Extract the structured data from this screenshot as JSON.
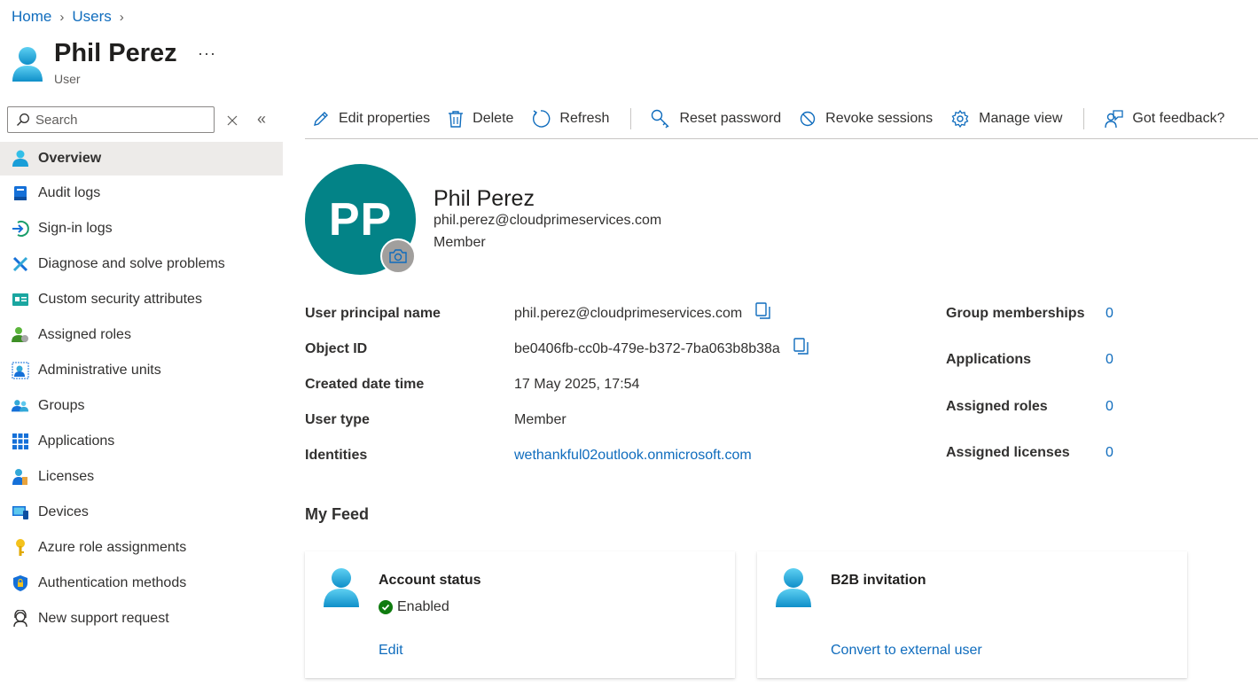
{
  "breadcrumb": {
    "home": "Home",
    "users": "Users"
  },
  "header": {
    "title": "Phil Perez",
    "subtitle": "User",
    "more": "···"
  },
  "search": {
    "placeholder": "Search"
  },
  "sidebar": {
    "items": [
      {
        "label": "Overview",
        "icon": "user-icon"
      },
      {
        "label": "Audit logs",
        "icon": "audit-log-icon"
      },
      {
        "label": "Sign-in logs",
        "icon": "sign-in-icon"
      },
      {
        "label": "Diagnose and solve problems",
        "icon": "wrench-icon"
      },
      {
        "label": "Custom security attributes",
        "icon": "attributes-icon"
      },
      {
        "label": "Assigned roles",
        "icon": "assigned-roles-icon"
      },
      {
        "label": "Administrative units",
        "icon": "admin-units-icon"
      },
      {
        "label": "Groups",
        "icon": "groups-icon"
      },
      {
        "label": "Applications",
        "icon": "applications-grid-icon"
      },
      {
        "label": "Licenses",
        "icon": "licenses-icon"
      },
      {
        "label": "Devices",
        "icon": "devices-icon"
      },
      {
        "label": "Azure role assignments",
        "icon": "key-icon"
      },
      {
        "label": "Authentication methods",
        "icon": "shield-icon"
      },
      {
        "label": "New support request",
        "icon": "support-icon"
      }
    ]
  },
  "toolbar": {
    "edit": "Edit properties",
    "delete": "Delete",
    "refresh": "Refresh",
    "reset_password": "Reset password",
    "revoke_sessions": "Revoke sessions",
    "manage_view": "Manage view",
    "feedback": "Got feedback?"
  },
  "profile": {
    "initials": "PP",
    "name": "Phil Perez",
    "email": "phil.perez@cloudprimeservices.com",
    "user_type": "Member"
  },
  "properties": {
    "upn_label": "User principal name",
    "upn_value": "phil.perez@cloudprimeservices.com",
    "objectid_label": "Object ID",
    "objectid_value": "be0406fb-cc0b-479e-b372-7ba063b8b38a",
    "created_label": "Created date time",
    "created_value": "17 May 2025, 17:54",
    "usertype_label": "User type",
    "usertype_value": "Member",
    "identities_label": "Identities",
    "identities_value": "wethankful02outlook.onmicrosoft.com"
  },
  "stats": {
    "groups_label": "Group memberships",
    "groups_value": "0",
    "apps_label": "Applications",
    "apps_value": "0",
    "roles_label": "Assigned roles",
    "roles_value": "0",
    "licenses_label": "Assigned licenses",
    "licenses_value": "0"
  },
  "feed": {
    "title": "My Feed",
    "account_title": "Account status",
    "account_status": "Enabled",
    "account_link": "Edit",
    "b2b_title": "B2B invitation",
    "b2b_link": "Convert to external user"
  },
  "colors": {
    "accent": "#0f6cbd",
    "avatar_bg": "#038387",
    "status_ok": "#107c10"
  }
}
